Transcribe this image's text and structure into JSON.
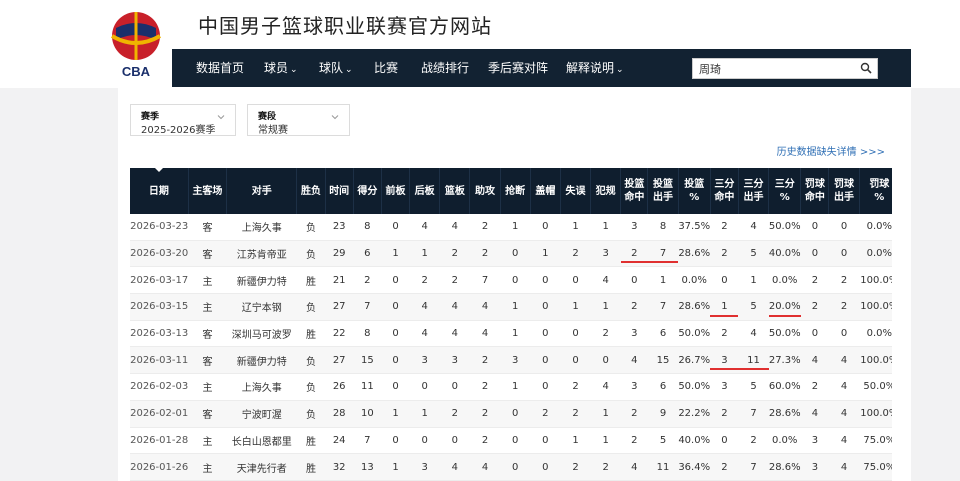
{
  "header": {
    "title": "中国男子篮球职业联赛官方网站",
    "logo_text": "CBA"
  },
  "nav": {
    "items": [
      {
        "label": "数据首页",
        "dropdown": false
      },
      {
        "label": "球员",
        "dropdown": true
      },
      {
        "label": "球队",
        "dropdown": true
      },
      {
        "label": "比赛",
        "dropdown": false
      },
      {
        "label": "战绩排行",
        "dropdown": false
      },
      {
        "label": "季后赛对阵",
        "dropdown": false
      },
      {
        "label": "解释说明",
        "dropdown": true
      }
    ],
    "arrow": "⌄",
    "search_value": "周琦"
  },
  "filters": {
    "season": {
      "label": "赛季",
      "value": "2025-2026赛季"
    },
    "stage": {
      "label": "赛段",
      "value": "常规赛"
    }
  },
  "history_link": "历史数据缺失详情 >>>",
  "table": {
    "headers": [
      "日期",
      "主客场",
      "对手",
      "胜负",
      "时间",
      "得分",
      "前板",
      "后板",
      "篮板",
      "助攻",
      "抢断",
      "盖帽",
      "失误",
      "犯规",
      "投篮\n命中",
      "投篮\n出手",
      "投篮\n%",
      "三分\n命中",
      "三分\n出手",
      "三分\n%",
      "罚球\n命中",
      "罚球\n出手",
      "罚球\n%"
    ],
    "rows": [
      [
        "2026-03-23",
        "客",
        "上海久事",
        "负",
        "23",
        "8",
        "0",
        "4",
        "4",
        "2",
        "1",
        "0",
        "1",
        "1",
        "3",
        "8",
        "37.5%",
        "2",
        "4",
        "50.0%",
        "0",
        "0",
        "0.0%"
      ],
      [
        "2026-03-20",
        "客",
        "江苏肯帝亚",
        "负",
        "29",
        "6",
        "1",
        "1",
        "2",
        "2",
        "0",
        "1",
        "2",
        "3",
        "2",
        "7",
        "28.6%",
        "2",
        "5",
        "40.0%",
        "0",
        "0",
        "0.0%"
      ],
      [
        "2026-03-17",
        "主",
        "新疆伊力特",
        "胜",
        "21",
        "2",
        "0",
        "2",
        "2",
        "7",
        "0",
        "0",
        "0",
        "4",
        "0",
        "1",
        "0.0%",
        "0",
        "1",
        "0.0%",
        "2",
        "2",
        "100.0%"
      ],
      [
        "2026-03-15",
        "主",
        "辽宁本钢",
        "负",
        "27",
        "7",
        "0",
        "4",
        "4",
        "4",
        "1",
        "0",
        "1",
        "1",
        "2",
        "7",
        "28.6%",
        "1",
        "5",
        "20.0%",
        "2",
        "2",
        "100.0%"
      ],
      [
        "2026-03-13",
        "客",
        "深圳马可波罗",
        "胜",
        "22",
        "8",
        "0",
        "4",
        "4",
        "4",
        "1",
        "0",
        "0",
        "2",
        "3",
        "6",
        "50.0%",
        "2",
        "4",
        "50.0%",
        "0",
        "0",
        "0.0%"
      ],
      [
        "2026-03-11",
        "客",
        "新疆伊力特",
        "负",
        "27",
        "15",
        "0",
        "3",
        "3",
        "2",
        "3",
        "0",
        "0",
        "0",
        "4",
        "15",
        "26.7%",
        "3",
        "11",
        "27.3%",
        "4",
        "4",
        "100.0%"
      ],
      [
        "2026-02-03",
        "主",
        "上海久事",
        "负",
        "26",
        "11",
        "0",
        "0",
        "0",
        "2",
        "1",
        "0",
        "2",
        "4",
        "3",
        "6",
        "50.0%",
        "3",
        "5",
        "60.0%",
        "2",
        "4",
        "50.0%"
      ],
      [
        "2026-02-01",
        "客",
        "宁波町渥",
        "负",
        "28",
        "10",
        "1",
        "1",
        "2",
        "2",
        "0",
        "2",
        "2",
        "1",
        "2",
        "9",
        "22.2%",
        "2",
        "7",
        "28.6%",
        "4",
        "4",
        "100.0%"
      ],
      [
        "2026-01-28",
        "主",
        "长白山恩都里",
        "胜",
        "24",
        "7",
        "0",
        "0",
        "0",
        "2",
        "0",
        "0",
        "1",
        "1",
        "2",
        "5",
        "40.0%",
        "0",
        "2",
        "0.0%",
        "3",
        "4",
        "75.0%"
      ],
      [
        "2026-01-26",
        "主",
        "天津先行者",
        "胜",
        "32",
        "13",
        "1",
        "3",
        "4",
        "4",
        "0",
        "0",
        "2",
        "2",
        "4",
        "11",
        "36.4%",
        "2",
        "7",
        "28.6%",
        "3",
        "4",
        "75.0%"
      ]
    ]
  },
  "colors": {
    "nav_bg": "#122232",
    "table_header_bg": "#0f1e2e",
    "page_bg": "#f2f2f3",
    "link": "#2f6fb5",
    "annotation_red": "#e03030"
  }
}
